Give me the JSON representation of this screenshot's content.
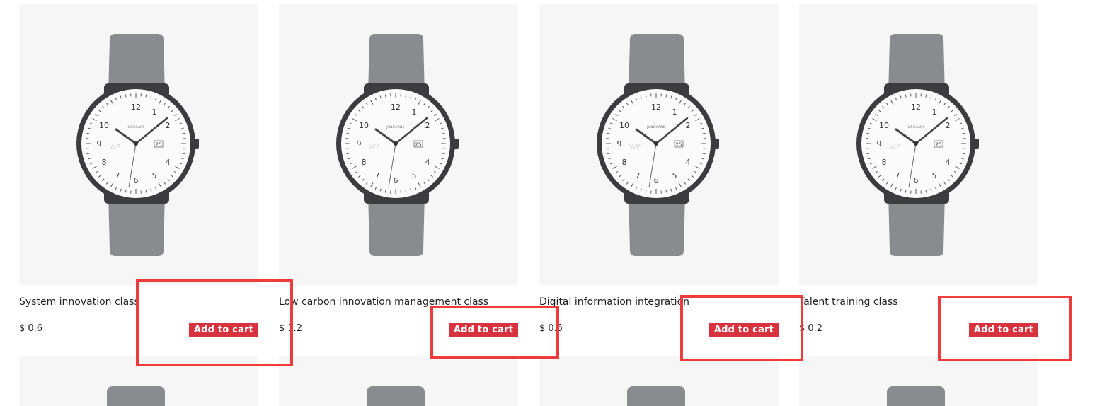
{
  "products": [
    {
      "title": "System innovation class",
      "price": "$ 0.6",
      "cart_label": "Add to cart",
      "watermark": "WP"
    },
    {
      "title": "Low carbon innovation management class",
      "price": "$ 1.2",
      "cart_label": "Add to cart",
      "watermark": "WP"
    },
    {
      "title": "Digital information integration",
      "price": "$ 0.5",
      "cart_label": "Add to cart",
      "watermark": "WP"
    },
    {
      "title": "Talent training class",
      "price": "$ 0.2",
      "cart_label": "Add to cart",
      "watermark": "WP"
    }
  ],
  "watch": {
    "brand": "JUNGHANS",
    "date": "25",
    "numerals": [
      "12",
      "1",
      "2",
      "4",
      "5",
      "6",
      "7",
      "8",
      "9",
      "10"
    ]
  },
  "colors": {
    "accent": "#d8323f",
    "highlight": "#ee3b3b",
    "card_bg": "#f6f6f6",
    "strap": "#8a8b8f"
  }
}
